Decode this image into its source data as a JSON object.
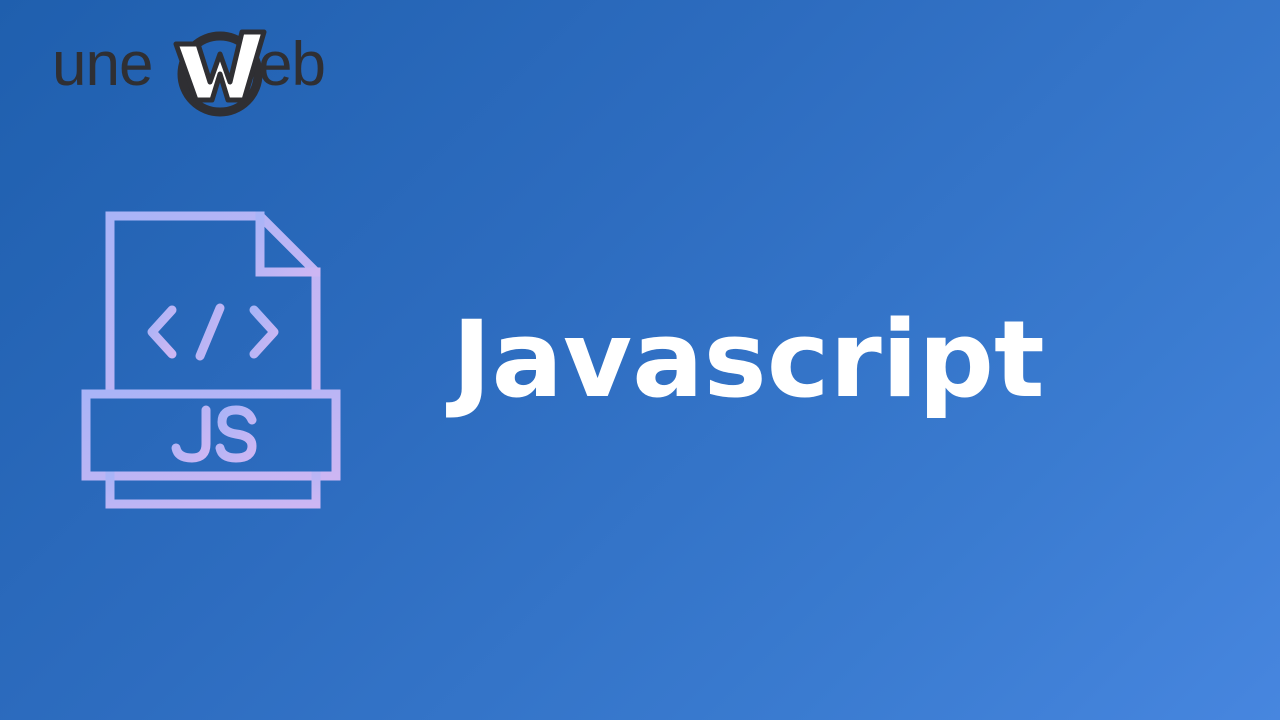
{
  "logo": {
    "text_left": "une",
    "text_right": "eb",
    "mark_icon": "w-monogram-icon",
    "text_color": "#2f2f33"
  },
  "file_icon": {
    "icon": "js-file-icon",
    "code_symbol": "</>",
    "badge": "JS",
    "stroke_color": "#b8a8f2"
  },
  "headline": "Javascript",
  "colors": {
    "background_start": "#1f5fae",
    "background_end": "#4786df",
    "headline": "#ffffff"
  }
}
